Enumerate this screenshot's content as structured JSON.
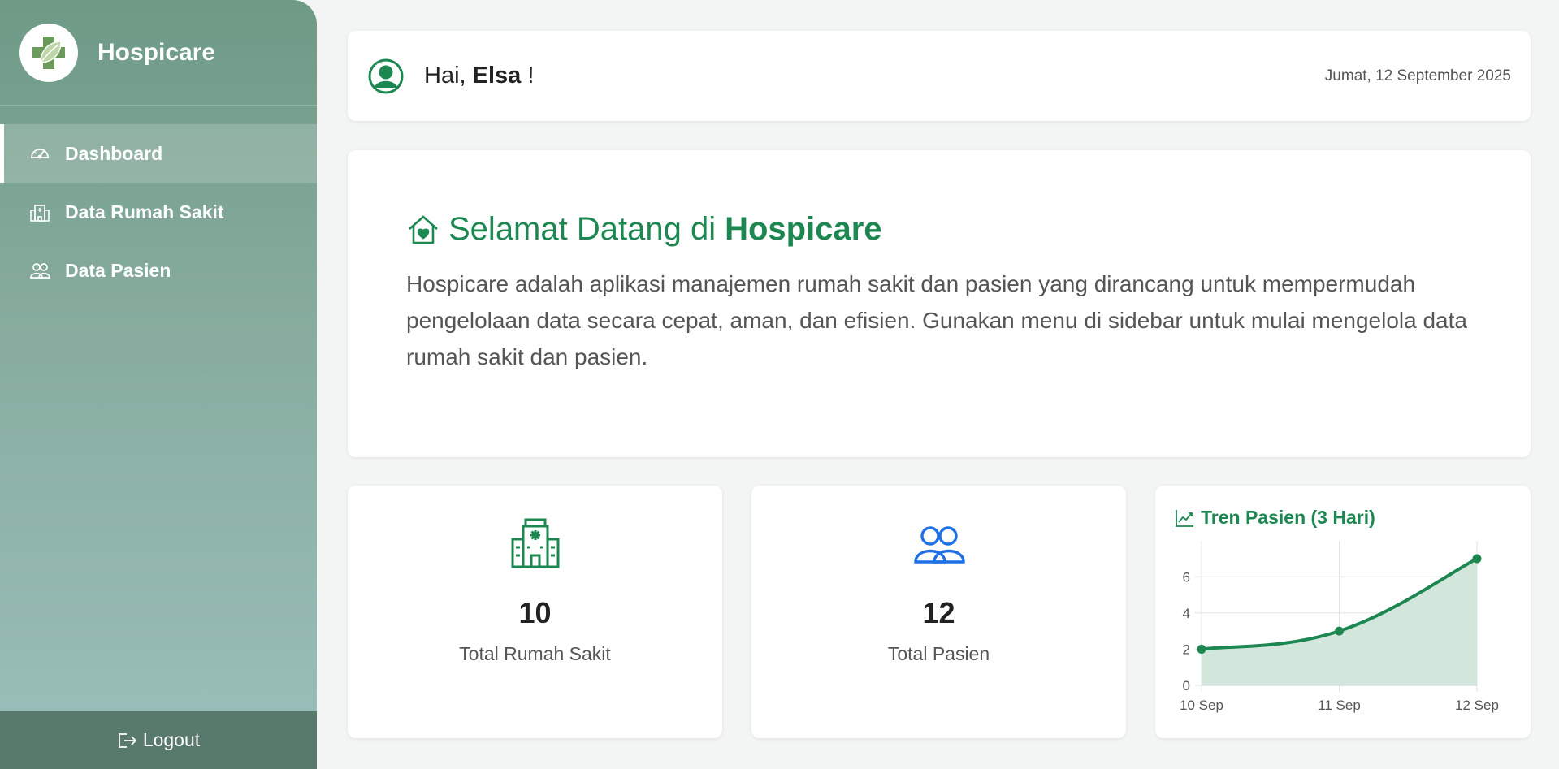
{
  "sidebar": {
    "brand_name": "Hospicare",
    "items": [
      {
        "label": "Dashboard",
        "icon": "speedometer-icon",
        "active": true
      },
      {
        "label": "Data Rumah Sakit",
        "icon": "hospital-icon",
        "active": false
      },
      {
        "label": "Data Pasien",
        "icon": "people-icon",
        "active": false
      }
    ],
    "logout_label": "Logout"
  },
  "header": {
    "greeting_prefix": "Hai, ",
    "user_name": "Elsa",
    "greeting_suffix": " !",
    "date": "Jumat, 12 September 2025"
  },
  "welcome": {
    "title_prefix": "Selamat Datang di",
    "title_brand": "Hospicare",
    "description": "Hospicare adalah aplikasi manajemen rumah sakit dan pasien yang dirancang untuk mempermudah pengelolaan data secara cepat, aman, dan efisien. Gunakan menu di sidebar untuk mulai mengelola data rumah sakit dan pasien."
  },
  "stats": [
    {
      "value": "10",
      "label": "Total Rumah Sakit",
      "icon": "hospital-icon",
      "color": "#1d8752"
    },
    {
      "value": "12",
      "label": "Total Pasien",
      "icon": "people-icon",
      "color": "#1f6fe5"
    }
  ],
  "colors": {
    "accent": "#1d8752",
    "sidebar_top": "#6e9a86",
    "sidebar_bottom": "#9bbfbb",
    "logout_bg": "#587a6d"
  },
  "chart_data": {
    "type": "area",
    "title": "Tren Pasien (3 Hari)",
    "categories": [
      "10 Sep",
      "11 Sep",
      "12 Sep"
    ],
    "series": [
      {
        "values": [
          2,
          3,
          7
        ]
      }
    ],
    "ylim": [
      0,
      7
    ],
    "yticks": [
      0,
      2,
      4,
      6
    ],
    "grid": true,
    "line_color": "#1d8752",
    "fill_color": "#d3e6dc"
  }
}
